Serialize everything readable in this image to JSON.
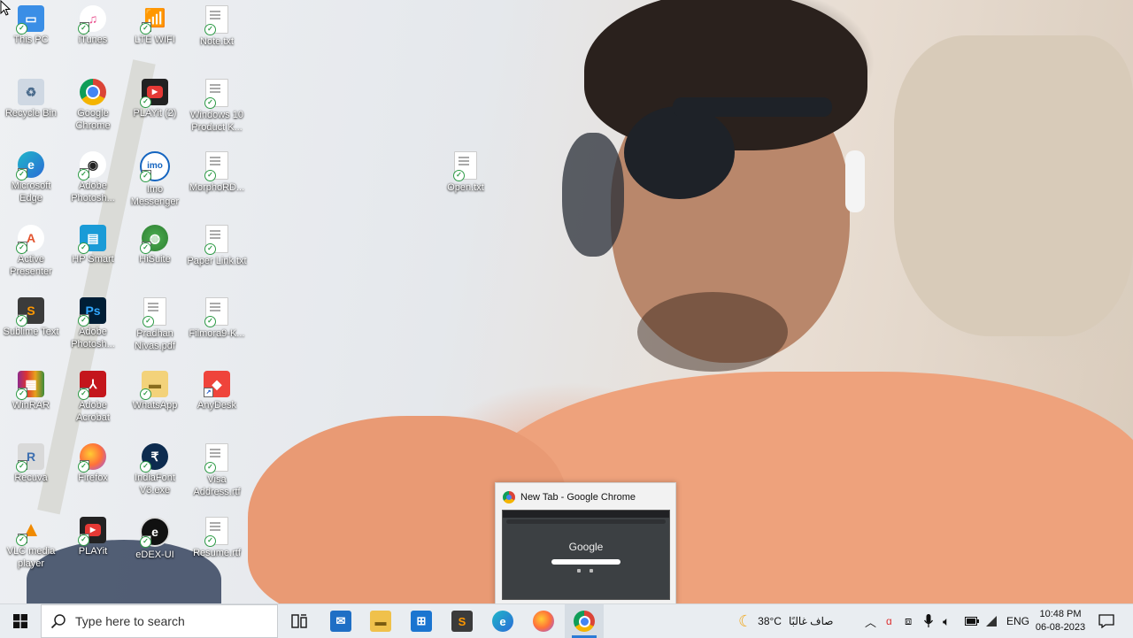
{
  "desktop_icons": [
    {
      "label": "This PC",
      "x": 0
    },
    {
      "label": "iTunes"
    },
    {
      "label": "LTE WIFI"
    },
    {
      "label": "Note.txt"
    },
    {
      "label": "Recycle Bin"
    },
    {
      "label": "Google Chrome"
    },
    {
      "label": "PLAYit (2)"
    },
    {
      "label": "Windows 10 Product K..."
    },
    {
      "label": "Microsoft Edge"
    },
    {
      "label": "Adobe Photosh..."
    },
    {
      "label": "Imo Messenger"
    },
    {
      "label": "MorphoRD..."
    },
    {
      "label": "Active Presenter"
    },
    {
      "label": "HP Smart"
    },
    {
      "label": "HiSuite"
    },
    {
      "label": "Paper Link.txt"
    },
    {
      "label": "Sublime Text"
    },
    {
      "label": "Adobe Photosh..."
    },
    {
      "label": "Pradhan Nivas.pdf"
    },
    {
      "label": "Filmora9-K..."
    },
    {
      "label": "WinRAR"
    },
    {
      "label": "Adobe Acrobat"
    },
    {
      "label": "WhatsApp"
    },
    {
      "label": "AnyDesk"
    },
    {
      "label": "Recuva"
    },
    {
      "label": "Firefox"
    },
    {
      "label": "IndiaFont V3.exe"
    },
    {
      "label": "Visa Address.rtf"
    },
    {
      "label": "VLC media player"
    },
    {
      "label": "PLAYit"
    },
    {
      "label": "eDEX-UI"
    },
    {
      "label": "Resume.rtf"
    },
    {
      "label": "Open.txt"
    }
  ],
  "preview": {
    "title": "New Tab - Google Chrome",
    "thumb_logo": "Google"
  },
  "taskbar": {
    "search_placeholder": "Type here to search",
    "weather_temp": "38°C",
    "weather_text": "صاف غالبًا",
    "language": "ENG",
    "time": "10:48 PM",
    "date": "06-08-2023"
  },
  "colors": {
    "taskbar_bg": "#e9edf1",
    "accent": "#2b7bd6",
    "check_green": "#2e9b47"
  }
}
